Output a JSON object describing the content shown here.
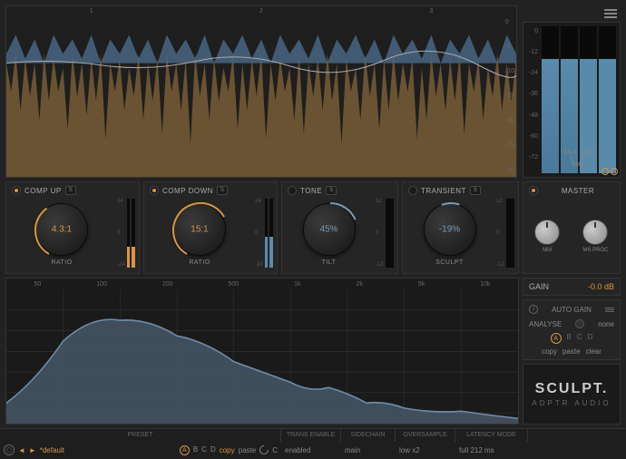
{
  "waveform": {
    "markers": [
      "1",
      "2",
      "3"
    ],
    "scale": [
      "0",
      "-5",
      "-10",
      "-15",
      "-20",
      "-25",
      "-30"
    ]
  },
  "output_meter": {
    "scale": [
      "0",
      "-12",
      "-24",
      "-36",
      "-48",
      "-60",
      "-72"
    ],
    "left_peak": "-13.4",
    "right_peak": "-13.2",
    "l_label": "L",
    "r_label": "R",
    "rms_label": "RMS"
  },
  "modules": {
    "comp_up": {
      "title": "COMP UP",
      "value": "4.3:1",
      "label": "RATIO",
      "scale_top": "24",
      "scale_bot": "-24"
    },
    "comp_down": {
      "title": "COMP DOWN",
      "value": "15:1",
      "label": "RATIO",
      "scale_top": "24",
      "scale_bot": "-24"
    },
    "tone": {
      "title": "TONE",
      "value": "45%",
      "label": "TILT",
      "scale_top": "12",
      "scale_bot": "-12"
    },
    "transient": {
      "title": "TRANSIENT",
      "value": "-19%",
      "label": "SCULPT",
      "scale_top": "12",
      "scale_bot": "-12"
    }
  },
  "master": {
    "title": "MASTER",
    "mix_label": "MIX",
    "ms_label": "MS PROC"
  },
  "spectrum": {
    "freqs": [
      "50",
      "100",
      "200",
      "500",
      "1k",
      "2k",
      "5k",
      "10k"
    ]
  },
  "gain": {
    "label": "GAIN",
    "value": "-0.0 dB"
  },
  "controls": {
    "auto_gain": "AUTO GAIN",
    "analyse": "ANALYSE",
    "analyse_val": "none",
    "a": "A",
    "b": "B",
    "c": "C",
    "d": "D",
    "copy": "copy",
    "paste": "paste",
    "clear": "clear"
  },
  "brand": {
    "main": "SCULPT.",
    "sub": "ADPTR AUDIO"
  },
  "footer": {
    "preset_header": "PRESET",
    "trans_header": "TRANS ENABLE",
    "side_header": "SIDECHAIN",
    "over_header": "OVERSAMPLE",
    "lat_header": "LATENCY MODE",
    "preset_arrows_l": "◄",
    "preset_arrows_r": "►",
    "preset_name": "*default",
    "copy": "copy",
    "paste": "paste",
    "trans_val": "enabled",
    "side_val": "main",
    "over_val": "low x2",
    "lat_val": "full 212 ms",
    "c_label": "C"
  }
}
